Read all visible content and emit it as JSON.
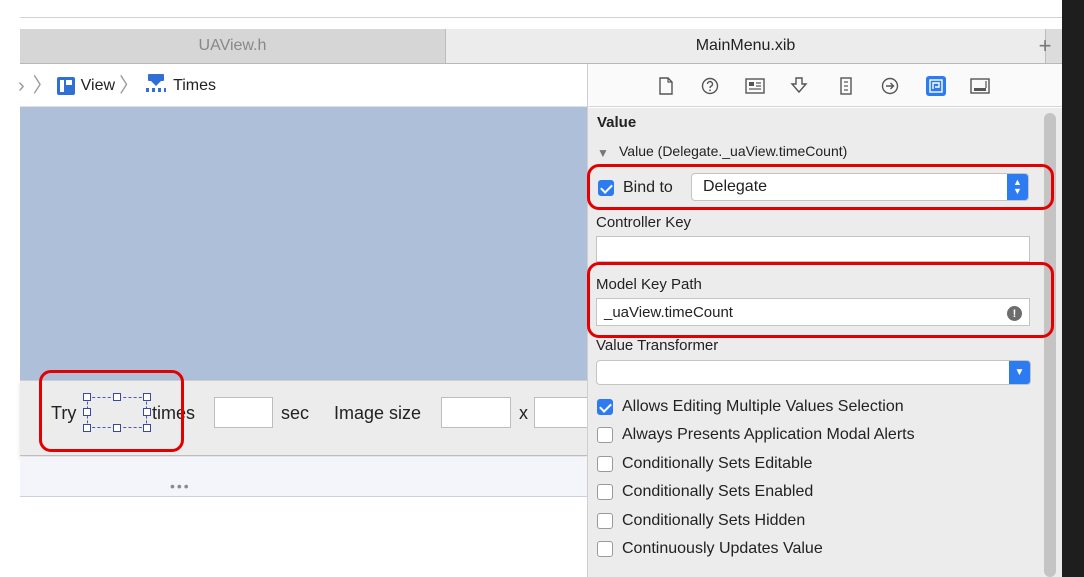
{
  "tabs": [
    {
      "label": "UAView.h"
    },
    {
      "label": "MainMenu.xib"
    }
  ],
  "tab_add_label": "+",
  "breadcrumb": {
    "leading_glyph": "›",
    "items": [
      "View",
      "Times"
    ],
    "separator": "〉"
  },
  "inspector_toolbar": {
    "icons": [
      "file-icon",
      "help-icon",
      "identity-icon",
      "attributes-icon",
      "size-icon",
      "connections-icon",
      "bindings-icon",
      "view-effects-icon"
    ],
    "active": "bindings-icon"
  },
  "canvas_window": {
    "try_label": "Try",
    "times_label": "times",
    "sec_label": "sec",
    "image_size_label": "Image size",
    "x_label": "x",
    "dots": "•••"
  },
  "inspector": {
    "section_title": "Value",
    "disclosure_label": "Value (Delegate._uaView.timeCount)",
    "bind_to_label": "Bind to",
    "bind_to_checked": true,
    "bind_to_value": "Delegate",
    "controller_key_label": "Controller Key",
    "controller_key_value": "",
    "model_key_path_label": "Model Key Path",
    "model_key_path_value": "_uaView.timeCount",
    "value_transformer_label": "Value Transformer",
    "value_transformer_value": "",
    "options": [
      {
        "label": "Allows Editing Multiple Values Selection",
        "checked": true
      },
      {
        "label": "Always Presents Application Modal Alerts",
        "checked": false
      },
      {
        "label": "Conditionally Sets Editable",
        "checked": false
      },
      {
        "label": "Conditionally Sets Enabled",
        "checked": false
      },
      {
        "label": "Conditionally Sets Hidden",
        "checked": false
      },
      {
        "label": "Continuously Updates Value",
        "checked": false
      }
    ]
  },
  "colors": {
    "accent": "#2d7bf0",
    "highlight_frame": "#e30000",
    "canvas_background": "#aebfd9"
  }
}
